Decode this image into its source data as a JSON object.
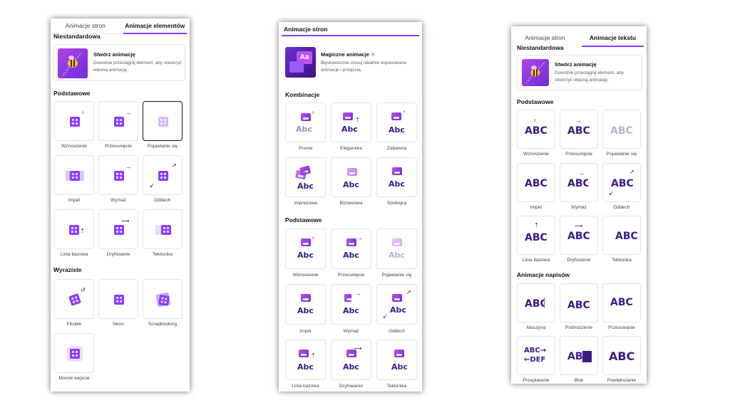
{
  "panel1": {
    "tabs": [
      "Animacje stron",
      "Animacje elementów"
    ],
    "custom_heading": "Niestandardowa",
    "custom_card": {
      "title": "Stwórz animację",
      "desc": "Dowolnie przeciągnij element, aby stworzyć własną animację."
    },
    "basic_heading": "Podstawowe",
    "basic": [
      "Wznoszenie",
      "Przesunięcie",
      "Pojawianie się",
      "Impet",
      "Wymaż",
      "Oddech",
      "Linia bazowa",
      "Dryfowanie",
      "Tektonika"
    ],
    "bold_heading": "Wyraziste",
    "bold": [
      "Fikołek",
      "Neon",
      "Scrapbooking",
      "Mocne wejście"
    ]
  },
  "panel2": {
    "tab": "Animacje stron",
    "magic_card": {
      "title": "Magiczne animacje",
      "badge": "✳",
      "desc": "Błyskawicznie stosuj idealnie dopasowane animacje i przejścia."
    },
    "combo_heading": "Kombinacje",
    "combos": [
      "Prosta",
      "Elegancka",
      "Zabawna",
      "Imprezowa",
      "Biznesowa",
      "Spokojna"
    ],
    "basic_heading": "Podstawowe",
    "basic": [
      "Wznoszenie",
      "Przesunięcie",
      "Pojawianie się",
      "Impet",
      "Wymaż",
      "Oddech",
      "Linia bazowa",
      "Dryfowanie",
      "Tektonika"
    ],
    "thumb_text": "Abc"
  },
  "panel3": {
    "tabs": [
      "Animacje stron",
      "Animacje tekstu"
    ],
    "custom_heading": "Niestandardowa",
    "custom_card": {
      "title": "Stwórz animację",
      "desc": "Dowolnie przeciągnij element, aby stworzyć własną animację."
    },
    "basic_heading": "Podstawowe",
    "basic": [
      "Wznoszenie",
      "Przesunięcie",
      "Pojawianie się",
      "Impet",
      "Wymaż",
      "Oddech",
      "Linia bazowa",
      "Dryfowanie",
      "Tektonika"
    ],
    "caption_heading": "Animacje napisów",
    "captions": [
      "Maszyna",
      "Podnoszenie",
      "Przesuwanie",
      "Przeplatanie",
      "Blok",
      "Powiększanie"
    ],
    "thumb_text": "ABC",
    "thumb_text_partial": "ABC",
    "weave_top": "ABC→",
    "weave_bottom": "←DEF"
  },
  "colors": {
    "accent": "#8b3dff",
    "text_purple": "#3b1a86"
  }
}
